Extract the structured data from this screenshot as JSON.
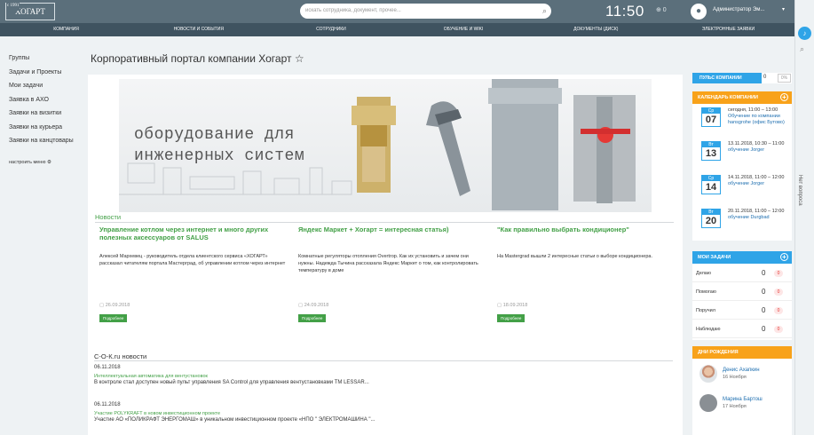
{
  "header": {
    "logo_text": "ХОГАРТ",
    "logo_tag": "с 1991",
    "search_placeholder": "искать сотрудника, документ, прочее...",
    "clock": "11:50",
    "clock_extra": "⊕ 0",
    "user_name": "Администратор Эм...",
    "user_menu": "▾"
  },
  "nav": [
    "КОМПАНИЯ",
    "НОВОСТИ И СОБЫТИЯ",
    "СОТРУДНИКИ",
    "ОБУЧЕНИЕ И WIKI",
    "ДОКУМЕНТЫ (ДИСК)",
    "ЭЛЕКТРОННЫЕ ЗАЯВКИ"
  ],
  "sidebar": {
    "items": [
      "Группы",
      "Задачи и Проекты",
      "Мои задачи",
      "Заявка в АХО",
      "Заявки на визитки",
      "Заявки на курьера",
      "Заявки на канцтовары"
    ],
    "configure": "настроить меню"
  },
  "page_title": "Корпоративный портал компании Хогарт",
  "title_star": "☆",
  "banner": {
    "line1": "оборудование для",
    "line2": "инженерных систем"
  },
  "news": {
    "heading": "Новости",
    "items": [
      {
        "title": "Управление котлом через интернет и много других полезных аксессуаров от SALUS",
        "body": "Алексей Мархевец - руководитель отдела клиентского сервиса «ХОГАРТ» рассказал читателям портала Мастерград, об управлении котлом через интернет",
        "date": "26.09.2018",
        "more": "Подробнее"
      },
      {
        "title": "Яндекс Маркет + Хогарт = интересная статья)",
        "body": "Комнатные регуляторы отопления Overtrop. Как их установить и зачем они нужны. Надежда Тычина рассказала Яндекс Маркет о том, как контролировать температуру в доме",
        "date": "24.09.2018",
        "more": "Подробнее"
      },
      {
        "title": "\"Как правильно выбрать кондиционер\"",
        "body": "На Mastergrad вышли 2 интересные статьи о выборе кондиционера.",
        "date": "18.09.2018",
        "more": "Подробнее"
      }
    ]
  },
  "cok": {
    "heading": "С-О-К.ru новости",
    "items": [
      {
        "date": "06.11.2018",
        "link": "Интеллектуальная автоматика для вентустановок",
        "text": "В контроле стал доступен новый пульт управления SA Control для управления вентустановками TM LESSAR..."
      },
      {
        "date": "06.11.2018",
        "link": "Участие POLYKRAFT в новом инвестиционном проекте",
        "text": "Участие АО «ПОЛИКРАФТ ЭНЕРГОМАШ» в уникальном инвестиционном проекте «НПО \" ЭЛЕКТРОМАШИНА \"..."
      }
    ]
  },
  "pulse": {
    "label": "ПУЛЬС КОМПАНИИ",
    "value": "0",
    "pct": "0%"
  },
  "calendar": {
    "label": "КАЛЕНДАРЬ КОМПАНИИ",
    "events": [
      {
        "dow": "Ср",
        "day": "07",
        "time": "сегодня, 11:00 – 13:00",
        "title": "Обучение по компании hansgrohe (офис Бутово)"
      },
      {
        "dow": "Вт",
        "day": "13",
        "time": "13.11.2018, 10:30 – 11:00",
        "title": "обучение Jorger"
      },
      {
        "dow": "Ср",
        "day": "14",
        "time": "14.11.2018, 11:00 – 12:00",
        "title": "обучение Jorger"
      },
      {
        "dow": "Вт",
        "day": "20",
        "time": "20.11.2018, 11:00 – 12:00",
        "title": "обучение Durgbad"
      }
    ]
  },
  "tasks": {
    "label": "МОИ ЗАДАЧИ",
    "rows": [
      {
        "label": "Делаю",
        "count": "0",
        "badge": "0"
      },
      {
        "label": "Помогаю",
        "count": "0",
        "badge": "0"
      },
      {
        "label": "Поручил",
        "count": "0",
        "badge": "0"
      },
      {
        "label": "Наблюдаю",
        "count": "0",
        "badge": "0"
      }
    ]
  },
  "birthdays": {
    "label": "ДНИ РОЖДЕНИЯ",
    "people": [
      {
        "name": "Денис Ахапкин",
        "date": "16 Ноября"
      },
      {
        "name": "Марина Бартош",
        "date": "17 Ноября"
      }
    ]
  },
  "right_rail": {
    "label": "Нет вопроса"
  }
}
